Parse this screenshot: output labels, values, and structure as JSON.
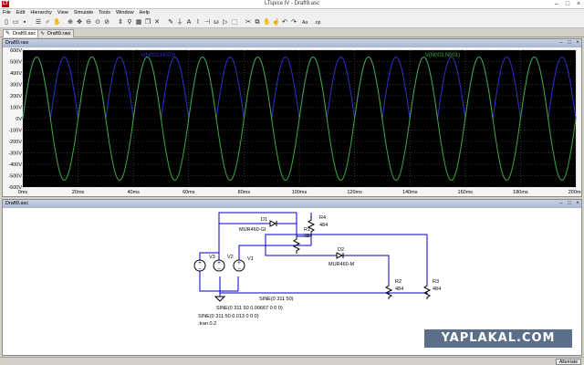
{
  "window": {
    "app_icon": "LT",
    "title": "LTspice IV - Draft9.asc"
  },
  "menu": {
    "items": [
      "File",
      "Edit",
      "Hierarchy",
      "View",
      "Simulate",
      "Tools",
      "Window",
      "Help"
    ]
  },
  "toolbar": {
    "icons": [
      "new-file-icon",
      "open-folder-icon",
      "save-icon",
      "settings-icon",
      "run-icon",
      "halt-icon",
      "zoom-in-icon",
      "pan-icon",
      "zoom-out-icon",
      "zoom-fit-icon",
      "zoom-cancel-icon",
      "autorange-icon",
      "probe-icon",
      "tile-icon",
      "cascade-icon",
      "close-icon",
      "wire-icon",
      "ground-icon",
      "label-icon",
      "resistor-icon",
      "capacitor-icon",
      "inductor-icon",
      "diode-icon",
      "component-icon",
      "cut-icon",
      "copy-icon",
      "move-icon",
      "drag-icon",
      "undo-icon",
      "redo-icon",
      "text-icon",
      "spice-directive-icon"
    ]
  },
  "tabs": [
    {
      "label": "Draft9.asc",
      "icon": "schematic-tab-icon"
    },
    {
      "label": "Draft9.raw",
      "icon": "waveform-tab-icon"
    }
  ],
  "waveform": {
    "pane_title": "Draft9.raw",
    "colors": {
      "background": "#000000",
      "grid": "#5a5a5a",
      "axis_text": "#c0c0c0"
    }
  },
  "chart_data": {
    "type": "line",
    "title": "",
    "xlabel": "",
    "ylabel": "",
    "x_unit": "ms",
    "y_unit": "V",
    "xlim": [
      0,
      200
    ],
    "ylim": [
      -600,
      600
    ],
    "grid": true,
    "legend": "top",
    "x_ticks": [
      "0ms",
      "20ms",
      "40ms",
      "60ms",
      "80ms",
      "100ms",
      "120ms",
      "140ms",
      "160ms",
      "180ms",
      "200ms"
    ],
    "y_ticks": [
      "600V",
      "500V",
      "400V",
      "300V",
      "200V",
      "100V",
      "0V",
      "-100V",
      "-200V",
      "-300V",
      "-400V",
      "-500V",
      "-600V"
    ],
    "series": [
      {
        "name": "V(N002,N003)",
        "color": "#3030c8",
        "waveform": "half-wave-rectified",
        "amplitude": 540,
        "frequency_hz": 50,
        "offset": 0
      },
      {
        "name": "V(N003,N001)",
        "color": "#3ca83c",
        "waveform": "sine",
        "amplitude": 540,
        "frequency_hz": 50,
        "offset": 0
      }
    ]
  },
  "schematic": {
    "pane_title": "Draft9.asc",
    "labels": {
      "d1": "D1",
      "d1_model": "MUR460-GI",
      "d2": "D2",
      "d2_model": "MUR460-M",
      "r4": "R4",
      "r4_value": "484",
      "r1": "R1",
      "r1_value": "484",
      "r2": "R2",
      "r2_value": "484",
      "r3": "R3",
      "r3_value": "484",
      "v1": "V1",
      "v2": "V2",
      "v3": "V3",
      "v1_value": "SINE(0 311 50)",
      "v2_value": "SINE(0 311 50 0.00667 0 0 0)",
      "v3_value": "SINE(0 311 50 0.013 0 0 0)",
      "directive": ".tran 0.2"
    }
  },
  "statusbar": {
    "status": "Alternate"
  },
  "watermark": {
    "text": "YAPLAKAL.COM"
  }
}
